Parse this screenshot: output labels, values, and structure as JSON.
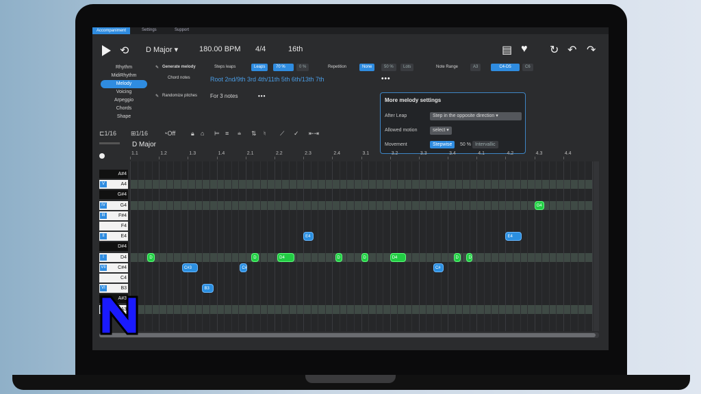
{
  "menu": {
    "items": [
      "Accompaniment",
      "Settings",
      "Support"
    ]
  },
  "transport": {
    "key": "D Major",
    "tempo": "180.00 BPM",
    "time_sig": "4/4",
    "grid": "16th"
  },
  "sidebar": {
    "items": [
      {
        "label": "Rhythm",
        "selected": false
      },
      {
        "label": "MidiRhythm",
        "selected": false
      },
      {
        "label": "Melody",
        "selected": true
      },
      {
        "label": "Voicing",
        "selected": false
      },
      {
        "label": "Arpeggio",
        "selected": false
      },
      {
        "label": "Chords",
        "selected": false
      },
      {
        "label": "Shape",
        "selected": false
      }
    ]
  },
  "melody": {
    "generate_label": "Generate melody",
    "steps_leaps_label": "Steps leaps",
    "steps_leaps_values": [
      "Leaps",
      "70 %",
      "0 %"
    ],
    "repetition_label": "Repetition",
    "repetition_values": [
      "None",
      "50 %",
      "Lots"
    ],
    "note_range_label": "Note Range",
    "note_range_values": [
      "A3",
      "C4-D5",
      "C6"
    ],
    "chord_notes_label": "Chord notes",
    "chord_notes_value": "Root 2nd/9th 3rd 4th/11th 5th 6th/13th 7th",
    "more_dots": "•••",
    "randomize_label": "Randomize pitches",
    "randomize_value": "For 3 notes"
  },
  "popup": {
    "title": "More melody settings",
    "after_leap_label": "After Leap",
    "after_leap_value": "Step in the opposite direction",
    "allowed_motion_label": "Allowed motion",
    "allowed_motion_value": "select",
    "movement_label": "Movement",
    "movement_values": [
      "Stepwise",
      "50 %",
      "Intervallic"
    ]
  },
  "toolbar2": {
    "quant_a": "1/16",
    "quant_b": "1/16",
    "offset": "Off"
  },
  "piano_roll": {
    "key_label": "D Major",
    "ruler": [
      "1.1",
      "1.2",
      "1.3",
      "1.4",
      "2.1",
      "2.2",
      "2.3",
      "2.4",
      "3.1",
      "3.2",
      "3.3",
      "3.4",
      "4.1",
      "4.2",
      "4.3",
      "4.4"
    ],
    "keys": [
      {
        "note": "A#4",
        "color": "black",
        "degree": ""
      },
      {
        "note": "A4",
        "color": "white",
        "degree": "V"
      },
      {
        "note": "G#4",
        "color": "black",
        "degree": ""
      },
      {
        "note": "G4",
        "color": "white",
        "degree": "IV"
      },
      {
        "note": "F#4",
        "color": "white",
        "degree": "III"
      },
      {
        "note": "F4",
        "color": "white",
        "degree": ""
      },
      {
        "note": "E4",
        "color": "white",
        "degree": "II"
      },
      {
        "note": "D#4",
        "color": "black",
        "degree": ""
      },
      {
        "note": "D4",
        "color": "white",
        "degree": "I"
      },
      {
        "note": "C#4",
        "color": "white",
        "degree": "VII"
      },
      {
        "note": "C4",
        "color": "white",
        "degree": ""
      },
      {
        "note": "B3",
        "color": "white",
        "degree": "VI"
      },
      {
        "note": "A#3",
        "color": "black",
        "degree": ""
      },
      {
        "note": "A3",
        "color": "white",
        "degree": "V"
      }
    ],
    "notes": [
      {
        "label": "D",
        "color": "green",
        "beat": 0.6,
        "len": 0.25,
        "pitch": "D4"
      },
      {
        "label": "C#3",
        "color": "blue",
        "beat": 1.8,
        "len": 0.55,
        "pitch": "C#4"
      },
      {
        "label": "B3",
        "color": "blue",
        "beat": 2.5,
        "len": 0.4,
        "pitch": "B3"
      },
      {
        "label": "C#",
        "color": "blue",
        "beat": 3.8,
        "len": 0.25,
        "pitch": "C#4"
      },
      {
        "label": "D",
        "color": "green",
        "beat": 4.2,
        "len": 0.25,
        "pitch": "D4"
      },
      {
        "label": "D4",
        "color": "green",
        "beat": 5.1,
        "len": 0.6,
        "pitch": "D4"
      },
      {
        "label": "E4",
        "color": "blue",
        "beat": 6.0,
        "len": 0.35,
        "pitch": "E4"
      },
      {
        "label": "D",
        "color": "green",
        "beat": 7.1,
        "len": 0.25,
        "pitch": "D4"
      },
      {
        "label": "D",
        "color": "green",
        "beat": 8.0,
        "len": 0.25,
        "pitch": "D4"
      },
      {
        "label": "D4",
        "color": "green",
        "beat": 9.0,
        "len": 0.55,
        "pitch": "D4"
      },
      {
        "label": "C#",
        "color": "blue",
        "beat": 10.5,
        "len": 0.35,
        "pitch": "C#4"
      },
      {
        "label": "D",
        "color": "green",
        "beat": 11.2,
        "len": 0.25,
        "pitch": "D4"
      },
      {
        "label": "D",
        "color": "green",
        "beat": 11.65,
        "len": 0.2,
        "pitch": "D4"
      },
      {
        "label": "E4",
        "color": "blue",
        "beat": 13.0,
        "len": 0.55,
        "pitch": "E4"
      },
      {
        "label": "G4",
        "color": "green",
        "beat": 14.0,
        "len": 0.35,
        "pitch": "G4"
      }
    ],
    "highlight_lanes": [
      "A4",
      "G4",
      "D4",
      "A3"
    ]
  }
}
